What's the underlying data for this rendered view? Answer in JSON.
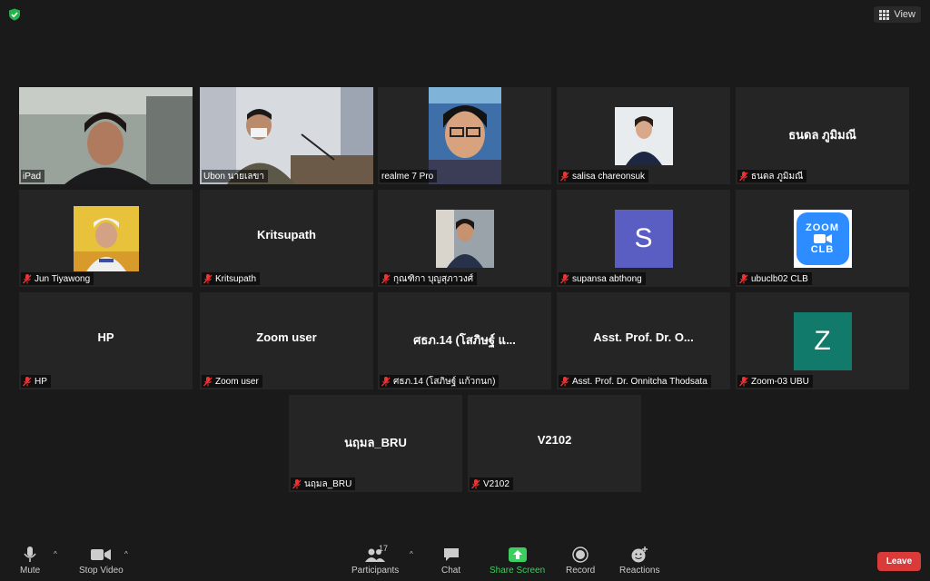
{
  "topbar": {
    "view_label": "View",
    "security": "shield-check-icon"
  },
  "colors": {
    "active_border": "#c9e86a",
    "share_green": "#3ccf5f",
    "leave_red": "#d93a3a",
    "tile_bg": "#252525"
  },
  "tiles": [
    {
      "label": "iPad",
      "center": "",
      "muted": false,
      "kind": "video",
      "active": true
    },
    {
      "label": "Ubon นายเลขา",
      "center": "",
      "muted": false,
      "kind": "video"
    },
    {
      "label": "realme 7 Pro",
      "center": "",
      "muted": false,
      "kind": "photo"
    },
    {
      "label": "salisa chareonsuk",
      "center": "",
      "muted": true,
      "kind": "photo"
    },
    {
      "label": "ธนดล ภูมิมณี",
      "center": "ธนดล ภูมิมณี",
      "muted": true,
      "kind": "name"
    },
    {
      "label": "Jun Tiyawong",
      "center": "",
      "muted": true,
      "kind": "photo"
    },
    {
      "label": "Kritsupath",
      "center": "Kritsupath",
      "muted": true,
      "kind": "name"
    },
    {
      "label": "กุณฑิกา บุญสุภาวงศ์",
      "center": "",
      "muted": true,
      "kind": "photo"
    },
    {
      "label": "supansa abthong",
      "center": "",
      "muted": true,
      "kind": "letter",
      "letter": "S",
      "color": "#5a5ec2"
    },
    {
      "label": "ubuclb02 CLB",
      "center": "",
      "muted": true,
      "kind": "logo",
      "logo_top": "ZOOM",
      "logo_bottom": "CLB"
    },
    {
      "label": "HP",
      "center": "HP",
      "muted": true,
      "kind": "name"
    },
    {
      "label": "Zoom user",
      "center": "Zoom user",
      "muted": true,
      "kind": "name"
    },
    {
      "label": "ศธภ.14 (โสภิษฐ์ แก้วกนก)",
      "center": "ศธภ.14 (โสภิษฐ์ แ...",
      "muted": true,
      "kind": "name"
    },
    {
      "label": "Asst. Prof. Dr. Onnitcha Thodsata",
      "center": "Asst. Prof. Dr. O...",
      "muted": true,
      "kind": "name"
    },
    {
      "label": "Zoom-03 UBU",
      "center": "",
      "muted": true,
      "kind": "letter",
      "letter": "Z",
      "color": "#127a6a"
    },
    {
      "label": "นฤมล_BRU",
      "center": "นฤมล_BRU",
      "muted": true,
      "kind": "name"
    },
    {
      "label": "V2102",
      "center": "V2102",
      "muted": true,
      "kind": "name"
    }
  ],
  "toolbar": {
    "mute": "Mute",
    "stop_video": "Stop Video",
    "participants": "Participants",
    "participants_count": "17",
    "chat": "Chat",
    "share_screen": "Share Screen",
    "record": "Record",
    "reactions": "Reactions",
    "leave": "Leave"
  }
}
